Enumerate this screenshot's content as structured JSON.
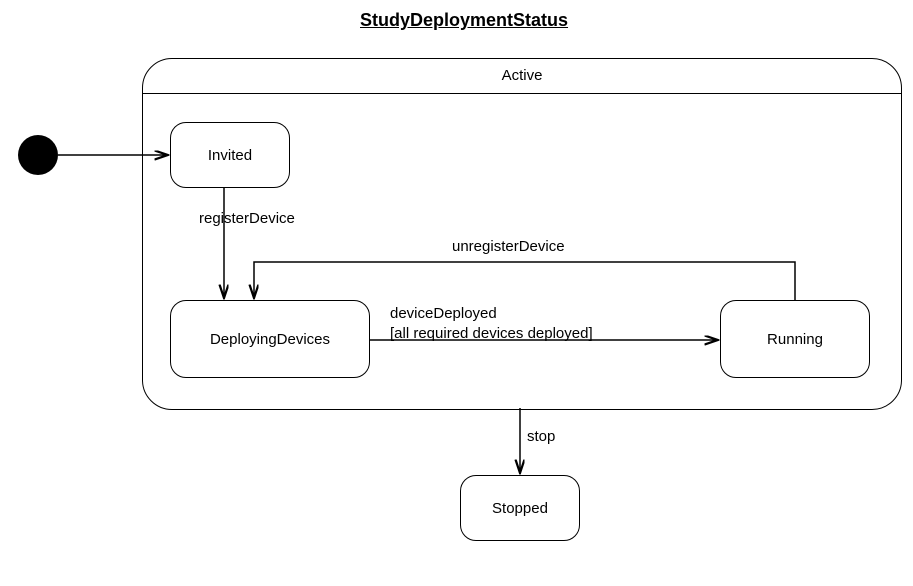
{
  "diagram": {
    "title": "StudyDeploymentStatus",
    "containerLabel": "Active",
    "states": {
      "invited": "Invited",
      "deploying": "DeployingDevices",
      "running": "Running",
      "stopped": "Stopped"
    },
    "transitions": {
      "registerDevice": "registerDevice",
      "unregisterDevice": "unregisterDevice",
      "deviceDeployed_line1": "deviceDeployed",
      "deviceDeployed_line2": "[all required devices deployed]",
      "stop": "stop"
    }
  }
}
